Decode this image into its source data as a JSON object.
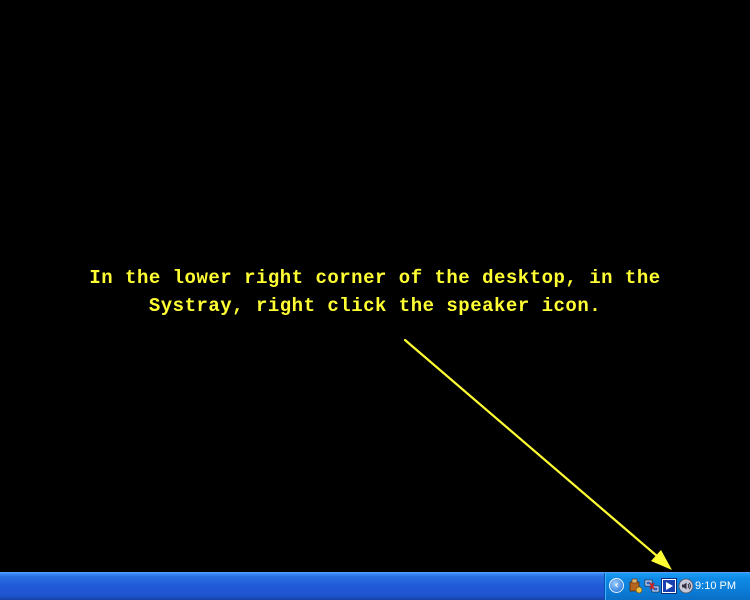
{
  "desktop": {
    "instruction_line1": "In the lower right corner of the desktop, in the",
    "instruction_line2": "Systray, right click the speaker icon.",
    "background_color": "#000000",
    "text_color": "#ffff33",
    "arrow_color": "#ffff33"
  },
  "taskbar": {
    "color": "#2159d8",
    "systray": {
      "expand_glyph": "‹",
      "icons": [
        "tray-app-icon",
        "network-icon",
        "media-player-icon",
        "speaker-icon"
      ],
      "clock": "9:10 PM"
    }
  }
}
